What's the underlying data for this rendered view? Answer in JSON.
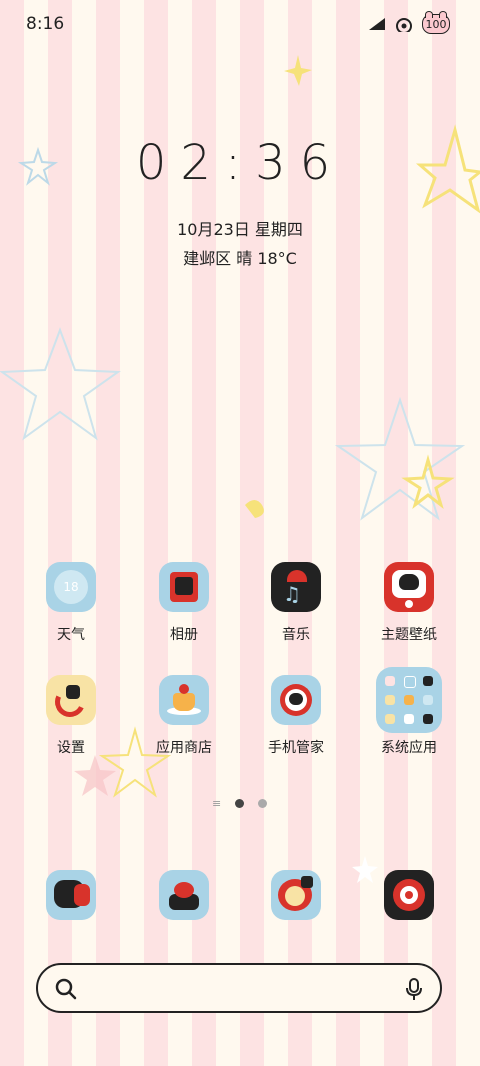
{
  "status_bar": {
    "time": "8:16",
    "battery": "100"
  },
  "lock_widget": {
    "clock": "02:36",
    "date": "10月23日 星期四",
    "weather": "建邺区 晴 18°C"
  },
  "apps_row1": [
    {
      "label": "天气",
      "icon": "weather-icon",
      "icon_text": "18"
    },
    {
      "label": "相册",
      "icon": "gallery-icon"
    },
    {
      "label": "音乐",
      "icon": "music-icon"
    },
    {
      "label": "主题壁纸",
      "icon": "themes-icon"
    }
  ],
  "apps_row2": [
    {
      "label": "设置",
      "icon": "settings-icon"
    },
    {
      "label": "应用商店",
      "icon": "app-store-icon"
    },
    {
      "label": "手机管家",
      "icon": "security-icon"
    },
    {
      "label": "系统应用",
      "icon": "system-apps-folder-icon"
    }
  ],
  "dock": [
    {
      "icon": "phone-icon"
    },
    {
      "icon": "messages-icon"
    },
    {
      "icon": "browser-icon"
    },
    {
      "icon": "camera-icon"
    }
  ],
  "colors": {
    "stripe_pink": "#fde3e3",
    "stripe_cream": "#fff9ef",
    "icon_blue": "#a9d3e6",
    "icon_red": "#d8332b"
  }
}
